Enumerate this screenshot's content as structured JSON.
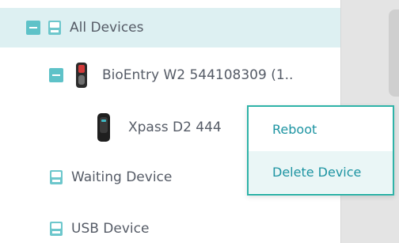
{
  "tree": {
    "all_devices": {
      "label": "All Devices",
      "expanded": true,
      "selected": true,
      "icon": "folder-icon"
    },
    "bioentry": {
      "label": "BioEntry W2 544108309 (1..",
      "expanded": true,
      "icon": "bioentry-device-icon"
    },
    "xpass": {
      "label": "Xpass D2 444",
      "icon": "xpass-device-icon"
    },
    "waiting": {
      "label": "Waiting Device",
      "icon": "folder-icon"
    },
    "usb": {
      "label": "USB Device",
      "icon": "folder-icon"
    }
  },
  "context_menu": {
    "items": [
      {
        "label": "Reboot"
      },
      {
        "label": "Delete Device",
        "highlighted": true
      }
    ]
  },
  "colors": {
    "accent": "#5ec2c8",
    "menu_border": "#2fb3a8",
    "menu_text": "#1d94a2",
    "selected_row": "#ddf0f2",
    "tree_text": "#555b66"
  }
}
